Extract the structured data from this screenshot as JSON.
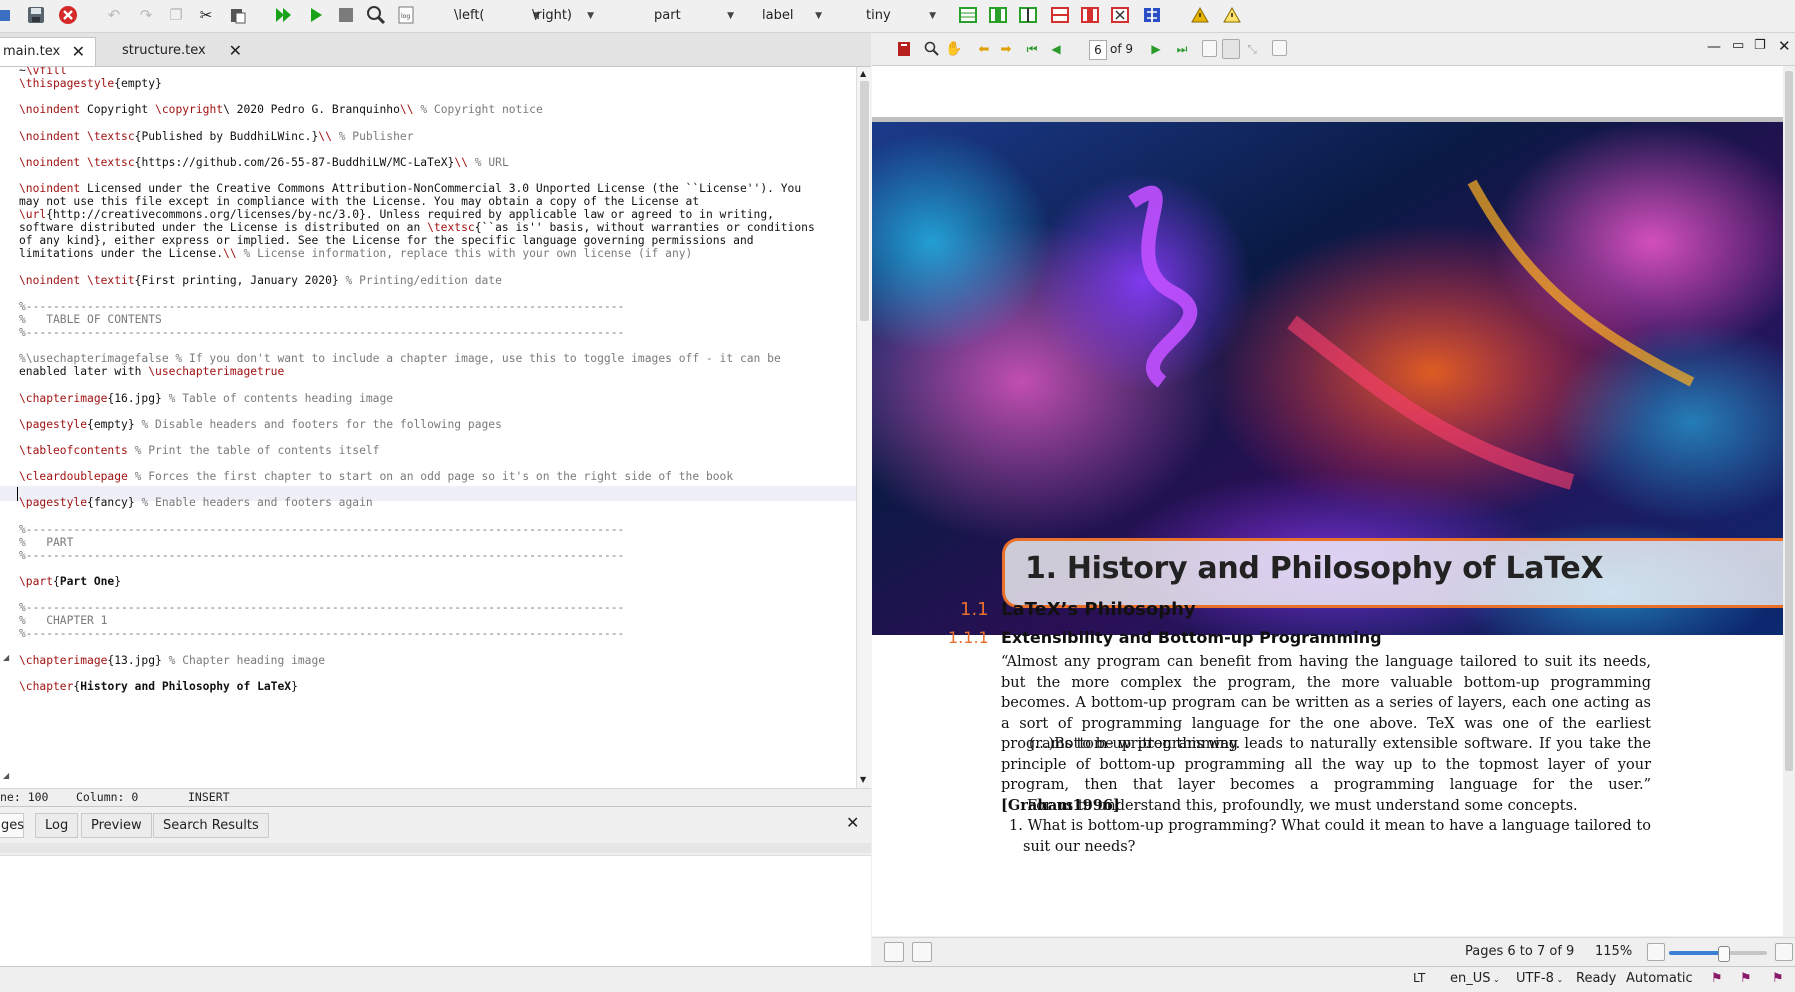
{
  "toolbar": {
    "dropdowns": [
      {
        "label": "\\left("
      },
      {
        "label": "\\right)"
      },
      {
        "label": "part"
      },
      {
        "label": "label"
      },
      {
        "label": "tiny"
      }
    ],
    "colors": {
      "run": "#1aa31a",
      "stop": "#d43030",
      "structure_green": "#2aa02a",
      "warn": "#e8b400"
    }
  },
  "tabs": [
    {
      "label": "main.tex"
    },
    {
      "label": "structure.tex"
    }
  ],
  "editor": {
    "lines": [
      "~\\vfill",
      "\\thispagestyle{empty}",
      "",
      "\\noindent Copyright \\copyright\\ 2020 Pedro G. Branquinho\\\\ % Copyright notice",
      "",
      "\\noindent \\textsc{Published by BuddhiLWinc.}\\\\ % Publisher",
      "",
      "\\noindent \\textsc{https://github.com/26-55-87-BuddhiLW/MC-LaTeX}\\\\ % URL",
      "",
      "\\noindent Licensed under the Creative Commons Attribution-NonCommercial 3.0 Unported License (the ``License''). You",
      "may not use this file except in compliance with the License. You may obtain a copy of the License at",
      "\\url{http://creativecommons.org/licenses/by-nc/3.0}. Unless required by applicable law or agreed to in writing,",
      "software distributed under the License is distributed on an \\textsc{``as is'' basis, without warranties or conditions",
      "of any kind}, either express or implied. See the License for the specific language governing permissions and",
      "limitations under the License.\\\\ % License information, replace this with your own license (if any)",
      "",
      "\\noindent \\textit{First printing, January 2020} % Printing/edition date",
      "",
      "%----------------------------------------------------------------------------------------",
      "%   TABLE OF CONTENTS",
      "%----------------------------------------------------------------------------------------",
      "",
      "%\\usechapterimagefalse % If you don't want to include a chapter image, use this to toggle images off - it can be",
      "enabled later with \\usechapterimagetrue",
      "",
      "\\chapterimage{16.jpg} % Table of contents heading image",
      "",
      "\\pagestyle{empty} % Disable headers and footers for the following pages",
      "",
      "\\tableofcontents % Print the table of contents itself",
      "",
      "\\cleardoublepage % Forces the first chapter to start on an odd page so it's on the right side of the book",
      "",
      "\\pagestyle{fancy} % Enable headers and footers again",
      "",
      "%----------------------------------------------------------------------------------------",
      "%   PART",
      "%----------------------------------------------------------------------------------------",
      "",
      "\\part{Part One}",
      "",
      "%----------------------------------------------------------------------------------------",
      "%   CHAPTER 1",
      "%----------------------------------------------------------------------------------------",
      "",
      "\\chapterimage{13.jpg} % Chapter heading image",
      "",
      "\\chapter{History and Philosophy of LaTeX}"
    ],
    "status": {
      "line": "ne: 100",
      "column": "Column: 0",
      "mode": "INSERT"
    }
  },
  "bottom_tabs": [
    {
      "label": "ges"
    },
    {
      "label": "Log"
    },
    {
      "label": "Preview"
    },
    {
      "label": "Search Results"
    }
  ],
  "pdf": {
    "page_input": "6",
    "page_total": "of 9",
    "chapter_title": "1. History and Philosophy of LaTeX",
    "section_num": "1.1",
    "section_title": "LaTeX’s Philosophy",
    "subsection_num": "1.1.1",
    "subsection_title": "Extensibility and Bottom-up Programming",
    "para1": "“Almost any program can benefit from having the language tailored to suit its needs, but the more complex the program, the more valuable bottom-up programming becomes. A bottom-up program can be written as a series of layers, each one acting as a sort of programming language for the one above. TeX was one of the earliest programs to be written this way.",
    "para2": "(...)Bottom-up programming leads to naturally extensible software. If you take the principle of bottom-up programming all the way up to the topmost layer of your program, then that layer becomes a programming language for the user.”",
    "citation": "[Graham1996]",
    "para3": "For us to understand this, profoundly, we must understand some concepts.",
    "list_item_1": "1.  What is bottom-up programming? What could it mean to have a language tailored to suit our needs?",
    "pages_status": "Pages 6 to 7 of 9",
    "zoom": "115%",
    "zoom_fraction": 0.55,
    "accent": "#e8702a"
  },
  "status_bar": {
    "language": "en_US",
    "encoding": "UTF-8",
    "state": "Ready",
    "mode": "Automatic"
  }
}
